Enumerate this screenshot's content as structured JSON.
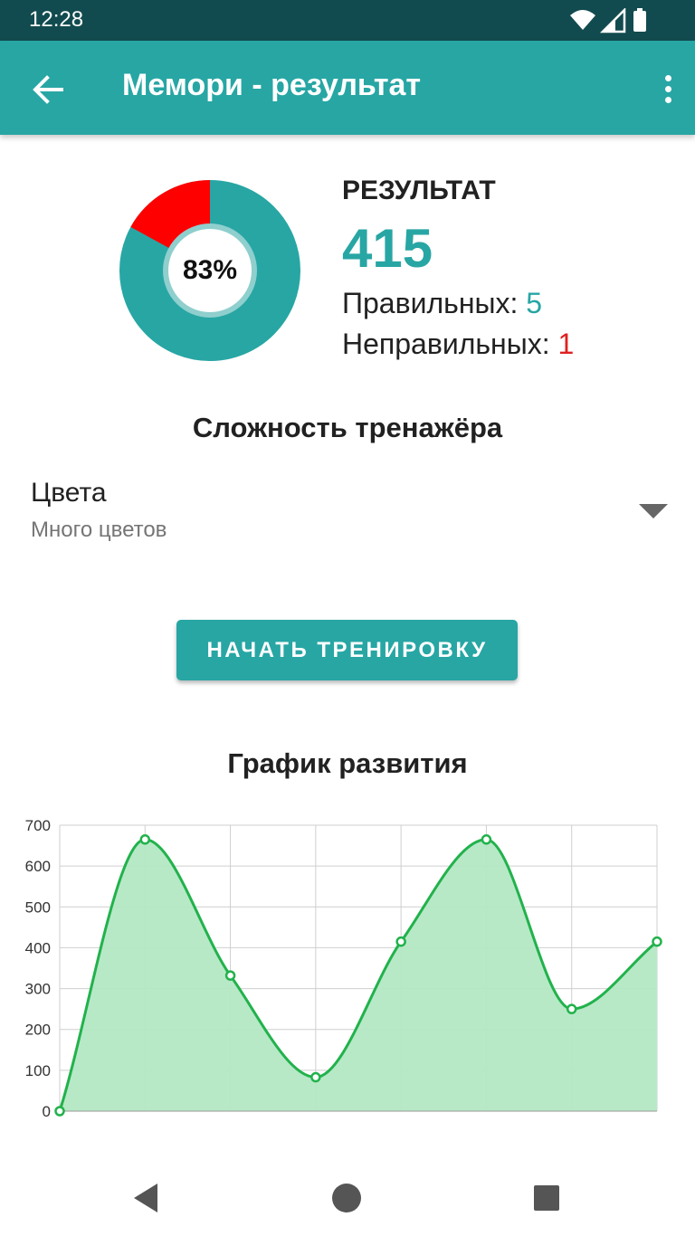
{
  "status_bar": {
    "time": "12:28",
    "icons": [
      "wifi-icon",
      "signal-icon",
      "battery-icon"
    ]
  },
  "app_bar": {
    "title": "Мемори - результат",
    "back_icon": "arrow-left-icon",
    "menu_icon": "more-vert-icon"
  },
  "result": {
    "percent_label": "83%",
    "correct_fraction": 0.83,
    "heading": "РЕЗУЛЬТАТ",
    "score": "415",
    "correct_label": "Правильных:",
    "correct_value": "5",
    "wrong_label": "Неправильных:",
    "wrong_value": "1"
  },
  "difficulty": {
    "title": "Сложность тренажёра",
    "label": "Цвета",
    "value": "Много цветов"
  },
  "start_button": {
    "label": "НАЧАТЬ ТРЕНИРОВКУ"
  },
  "progress": {
    "title": "График развития"
  },
  "chart_data": {
    "type": "area",
    "x": [
      0,
      1,
      2,
      3,
      4,
      5,
      6,
      7
    ],
    "values": [
      0,
      665,
      332,
      83,
      415,
      665,
      250,
      415
    ],
    "ylim": [
      0,
      700
    ],
    "yticks": [
      0,
      100,
      200,
      300,
      400,
      500,
      600,
      700
    ],
    "grid": true
  },
  "colors": {
    "primary": "#27a6a4",
    "status_bar": "#124b4f",
    "wrong": "#ff0000",
    "line": "#22b24c",
    "fill": "#b3e8c4"
  },
  "nav_bar": {
    "icons": [
      "back-triangle-icon",
      "home-circle-icon",
      "recents-square-icon"
    ]
  }
}
